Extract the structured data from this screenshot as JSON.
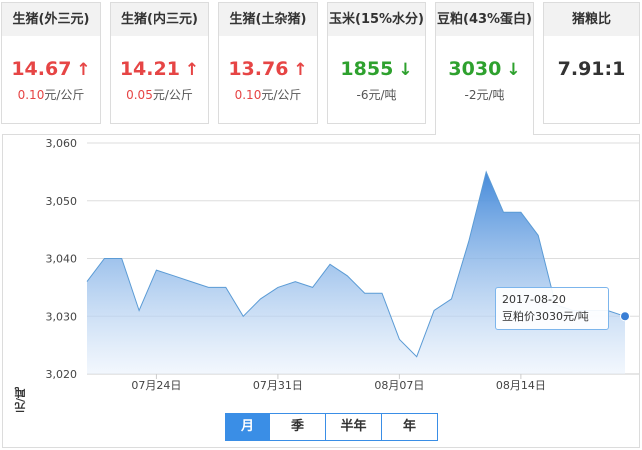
{
  "cards": [
    {
      "title": "生猪(外三元)",
      "value": "14.67",
      "arrow": "↑",
      "trend": "up",
      "change_num": "0.10",
      "change_unit": "元/公斤"
    },
    {
      "title": "生猪(内三元)",
      "value": "14.21",
      "arrow": "↑",
      "trend": "up",
      "change_num": "0.05",
      "change_unit": "元/公斤"
    },
    {
      "title": "生猪(土杂猪)",
      "value": "13.76",
      "arrow": "↑",
      "trend": "up",
      "change_num": "0.10",
      "change_unit": "元/公斤"
    },
    {
      "title": "玉米(15%水分)",
      "value": "1855",
      "arrow": "↓",
      "trend": "down",
      "change_num": "-6",
      "change_unit": "元/吨"
    },
    {
      "title": "豆粕(43%蛋白)",
      "value": "3030",
      "arrow": "↓",
      "trend": "down",
      "change_num": "-2",
      "change_unit": "元/吨"
    },
    {
      "title": "猪粮比",
      "value": "7.91:1",
      "arrow": "",
      "trend": "neutral",
      "change_num": "",
      "change_unit": ""
    }
  ],
  "selected_card": 4,
  "colors": {
    "up": "#e64545",
    "down": "#2ea12e",
    "accent": "#3a8ee6",
    "line": "#5b9bd5",
    "fill_top": "#3d85d8",
    "fill_bottom": "#eaf2fc"
  },
  "chart_data": {
    "type": "area",
    "ylabel": "元/吨",
    "ylim": [
      3020,
      3060
    ],
    "yticks": [
      3020,
      3030,
      3040,
      3050,
      3060
    ],
    "ytick_labels": [
      "3,020",
      "3,030",
      "3,040",
      "3,050",
      "3,060"
    ],
    "x_range": [
      "2017-07-20",
      "2017-08-20"
    ],
    "xticks": [
      "2017-07-24",
      "2017-07-31",
      "2017-08-07",
      "2017-08-14"
    ],
    "xtick_labels": [
      "07月24日",
      "07月31日",
      "08月07日",
      "08月14日"
    ],
    "grid": true,
    "series": [
      {
        "x": [
          "2017-07-20",
          "2017-07-21",
          "2017-07-22",
          "2017-07-23",
          "2017-07-24",
          "2017-07-25",
          "2017-07-26",
          "2017-07-27",
          "2017-07-28",
          "2017-07-29",
          "2017-07-30",
          "2017-07-31",
          "2017-08-01",
          "2017-08-02",
          "2017-08-03",
          "2017-08-04",
          "2017-08-05",
          "2017-08-06",
          "2017-08-07",
          "2017-08-08",
          "2017-08-09",
          "2017-08-10",
          "2017-08-11",
          "2017-08-12",
          "2017-08-13",
          "2017-08-14",
          "2017-08-15",
          "2017-08-16",
          "2017-08-17",
          "2017-08-18",
          "2017-08-19",
          "2017-08-20"
        ],
        "values": [
          3036,
          3040,
          3040,
          3031,
          3038,
          3037,
          3036,
          3035,
          3035,
          3030,
          3033,
          3035,
          3036,
          3035,
          3039,
          3037,
          3034,
          3034,
          3026,
          3023,
          3031,
          3033,
          3043,
          3055,
          3048,
          3048,
          3044,
          3032,
          3031,
          3031,
          3031,
          3030
        ]
      }
    ],
    "tooltip": {
      "date": "2017-08-20",
      "label": "豆粕价3030元/吨"
    }
  },
  "range_tabs": [
    "月",
    "季",
    "半年",
    "年"
  ],
  "active_range": 0
}
